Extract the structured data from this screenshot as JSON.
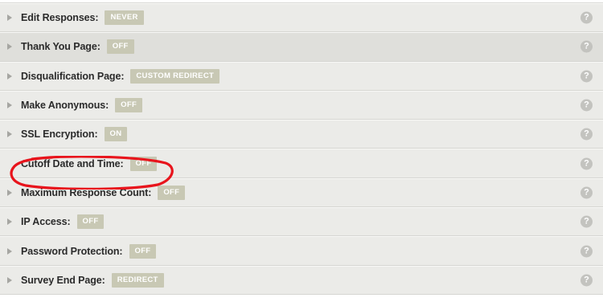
{
  "settings": [
    {
      "label": "Edit Responses:",
      "value": "NEVER"
    },
    {
      "label": "Thank You Page:",
      "value": "OFF"
    },
    {
      "label": "Disqualification Page:",
      "value": "CUSTOM REDIRECT"
    },
    {
      "label": "Make Anonymous:",
      "value": "OFF"
    },
    {
      "label": "SSL Encryption:",
      "value": "ON"
    },
    {
      "label": "Cutoff Date and Time:",
      "value": "OFF"
    },
    {
      "label": "Maximum Response Count:",
      "value": "OFF"
    },
    {
      "label": "IP Access:",
      "value": "OFF"
    },
    {
      "label": "Password Protection:",
      "value": "OFF"
    },
    {
      "label": "Survey End Page:",
      "value": "REDIRECT"
    }
  ],
  "help_glyph": "?",
  "annotation_color": "#e8141c",
  "badge_color": "#c8c8b4"
}
